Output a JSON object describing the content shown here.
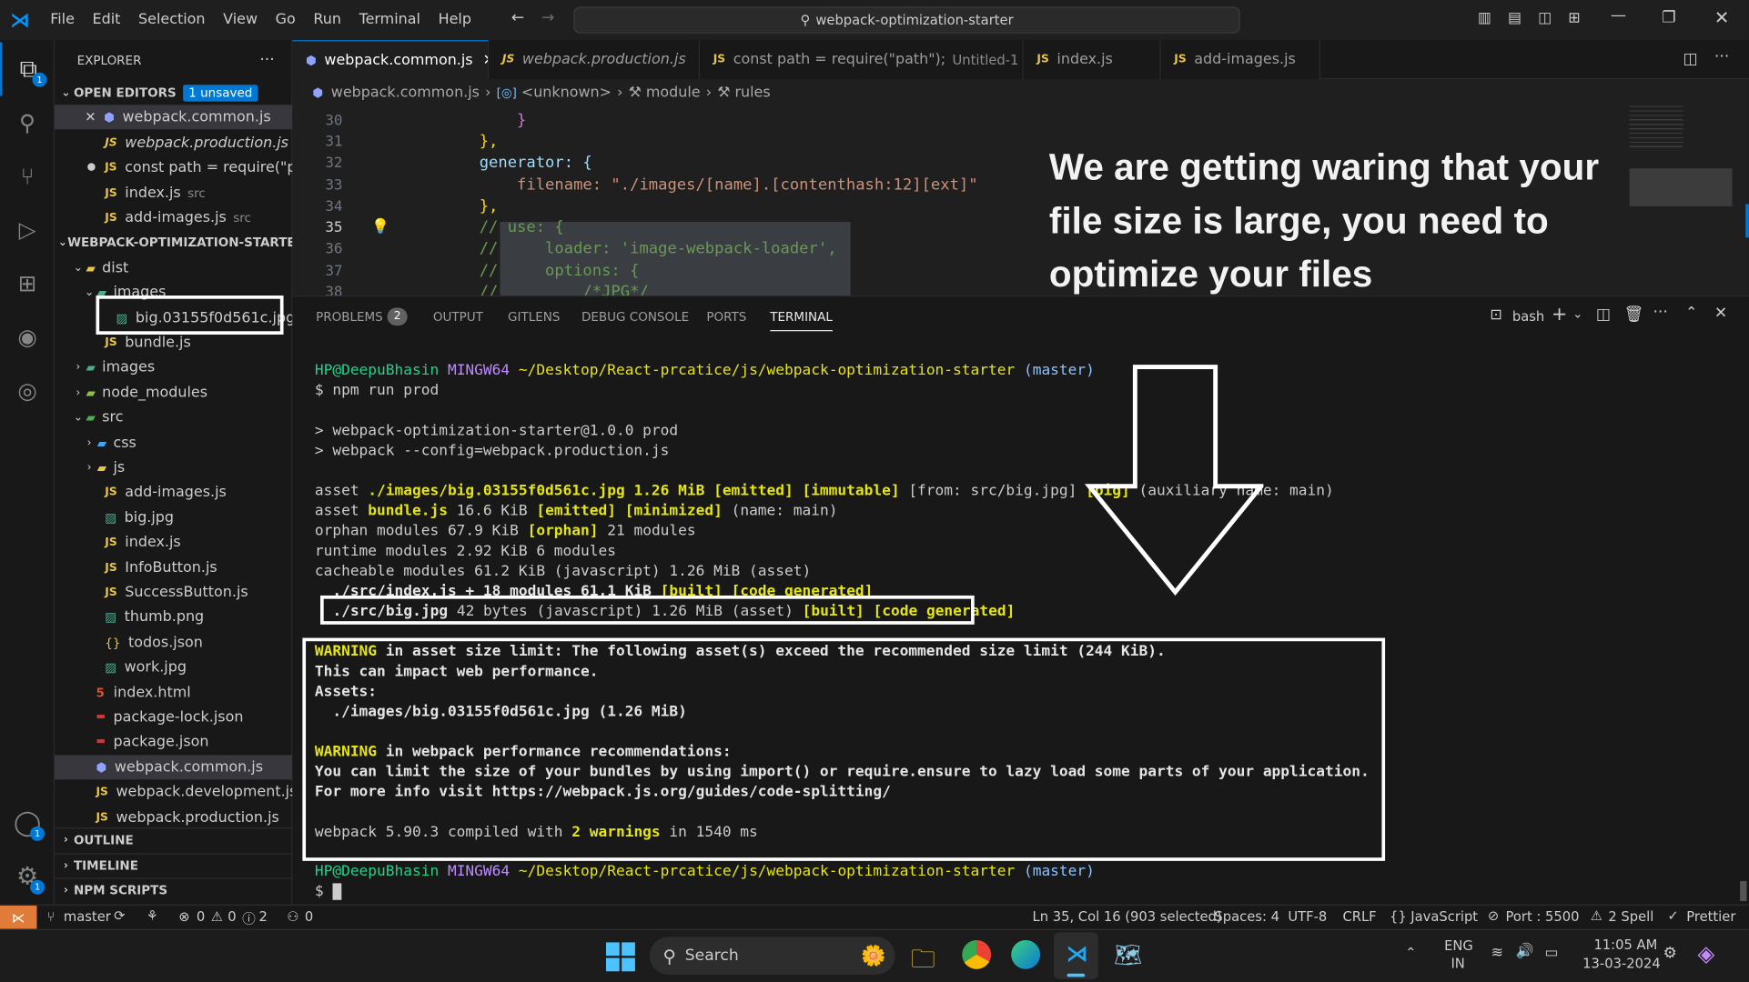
{
  "titlebar": {
    "menus": [
      "File",
      "Edit",
      "Selection",
      "View",
      "Go",
      "Run",
      "Terminal",
      "Help"
    ],
    "search": "webpack-optimization-starter"
  },
  "activity": {
    "explorer_badge": "1",
    "account_badge": "1",
    "settings_badge": "1"
  },
  "sidebar": {
    "title": "EXPLORER",
    "open_editors": {
      "label": "OPEN EDITORS",
      "badge": "1 unsaved",
      "items": [
        {
          "name": "webpack.common.js",
          "hint": ""
        },
        {
          "name": "webpack.production.js",
          "hint": ""
        },
        {
          "name": "const path = require(\"p...",
          "hint": ""
        },
        {
          "name": "index.js",
          "hint": "src"
        },
        {
          "name": "add-images.js",
          "hint": "src"
        }
      ]
    },
    "project": "WEBPACK-OPTIMIZATION-STARTER",
    "tree": [
      {
        "label": "dist"
      },
      {
        "label": "images"
      },
      {
        "label": "big.03155f0d561c.jpg"
      },
      {
        "label": "bundle.js"
      },
      {
        "label": "images"
      },
      {
        "label": "node_modules"
      },
      {
        "label": "src"
      },
      {
        "label": "css"
      },
      {
        "label": "js"
      },
      {
        "label": "add-images.js"
      },
      {
        "label": "big.jpg"
      },
      {
        "label": "index.js"
      },
      {
        "label": "InfoButton.js"
      },
      {
        "label": "SuccessButton.js"
      },
      {
        "label": "thumb.png"
      },
      {
        "label": "todos.json"
      },
      {
        "label": "work.jpg"
      },
      {
        "label": "index.html"
      },
      {
        "label": "package-lock.json"
      },
      {
        "label": "package.json"
      },
      {
        "label": "webpack.common.js"
      },
      {
        "label": "webpack.development.js"
      },
      {
        "label": "webpack.production.js"
      }
    ],
    "outline": "OUTLINE",
    "timeline": "TIMELINE",
    "npm": "NPM SCRIPTS"
  },
  "tabs": [
    "webpack.common.js",
    "webpack.production.js",
    "const path = require(\"path\");",
    "index.js",
    "add-images.js"
  ],
  "tab_untitled": "Untitled-1",
  "breadcrumb": [
    "webpack.common.js",
    "<unknown>",
    "module",
    "rules"
  ],
  "code": {
    "line_numbers": [
      "30",
      "31",
      "32",
      "33",
      "34",
      "35",
      "36",
      "37",
      "38"
    ],
    "lines": [
      "            }",
      "        },",
      "        generator: {",
      "            filename: \"./images/[name].[contenthash:12][ext]\"",
      "        },",
      "        // use: {",
      "        //     loader: 'image-webpack-loader',",
      "        //     options: {",
      "        //         /*JPG*/"
    ]
  },
  "overlay_text": "We are getting waring that your file size is large, you need to optimize your files",
  "panel": {
    "tabs": [
      "PROBLEMS",
      "OUTPUT",
      "GITLENS",
      "DEBUG CONSOLE",
      "PORTS",
      "TERMINAL"
    ],
    "problems_count": "2",
    "shell": "bash"
  },
  "terminal": {
    "user": "HP@DeepuBhasin",
    "env": "MINGW64",
    "path": "~/Desktop/React-prcatice/js/webpack-optimization-starter",
    "branch": "(master)",
    "cmd": "$ npm run prod",
    "l_prod": "> webpack-optimization-starter@1.0.0 prod",
    "l_cfg": "> webpack --config=webpack.production.js",
    "a1_pre": "asset ",
    "a1_file": "./images/big.03155f0d561c.jpg 1.26 MiB [emitted] [immutable]",
    "a1_from": " [from: src/big.jpg] ",
    "a1_big": "[big]",
    "a1_aux": " (auxiliary name: main)",
    "a2_pre": "asset ",
    "a2_file": "bundle.js",
    "a2_size": " 16.6 KiB ",
    "a2_tags": "[emitted] [minimized]",
    "a2_name": " (name: main)",
    "orphan_pre": "orphan modules 67.9 KiB ",
    "orphan_tag": "[orphan]",
    "orphan_post": " 21 modules",
    "runtime": "runtime modules 2.92 KiB 6 modules",
    "cacheable": "cacheable modules 61.2 KiB (javascript) 1.26 MiB (asset)",
    "src_index_pre": "  ./src/index.js + 18 modules 61.1 KiB ",
    "src_index_tag": "[built] [code generated]",
    "src_big_pre": "./src/big.jpg",
    "src_big_mid": " 42 bytes (javascript) 1.26 MiB (asset) ",
    "src_big_tag": "[built] [code generated]",
    "warn1_a": "WARNING",
    "warn1_b": " in asset size limit: The following asset(s) exceed the recommended size limit (244 KiB).",
    "warn1_c": "This can impact web performance.",
    "warn1_d": "Assets:",
    "warn1_e": "  ./images/big.03155f0d561c.jpg (1.26 MiB)",
    "warn2_a": "WARNING",
    "warn2_b": " in webpack performance recommendations:",
    "warn2_c": "You can limit the size of your bundles by using import() or require.ensure to lazy load some parts of your application.",
    "warn2_d": "For more info visit https://webpack.js.org/guides/code-splitting/",
    "done_a": "webpack 5.90.3 compiled with ",
    "done_b": "2 warnings",
    "done_c": " in 1540 ms",
    "prompt": "$"
  },
  "status": {
    "branch": "master",
    "errors": "0",
    "warnings": "0",
    "infos": "2",
    "ports": "0",
    "position": "Ln 35, Col 16 (903 selected)",
    "spaces": "Spaces: 4",
    "encoding": "UTF-8",
    "eol": "CRLF",
    "language": "JavaScript",
    "port": "Port : 5500",
    "spell": "2 Spell",
    "prettier": "Prettier"
  },
  "taskbar": {
    "search": "Search",
    "lang1": "ENG",
    "lang2": "IN",
    "time": "11:05 AM",
    "date": "13-03-2024"
  }
}
